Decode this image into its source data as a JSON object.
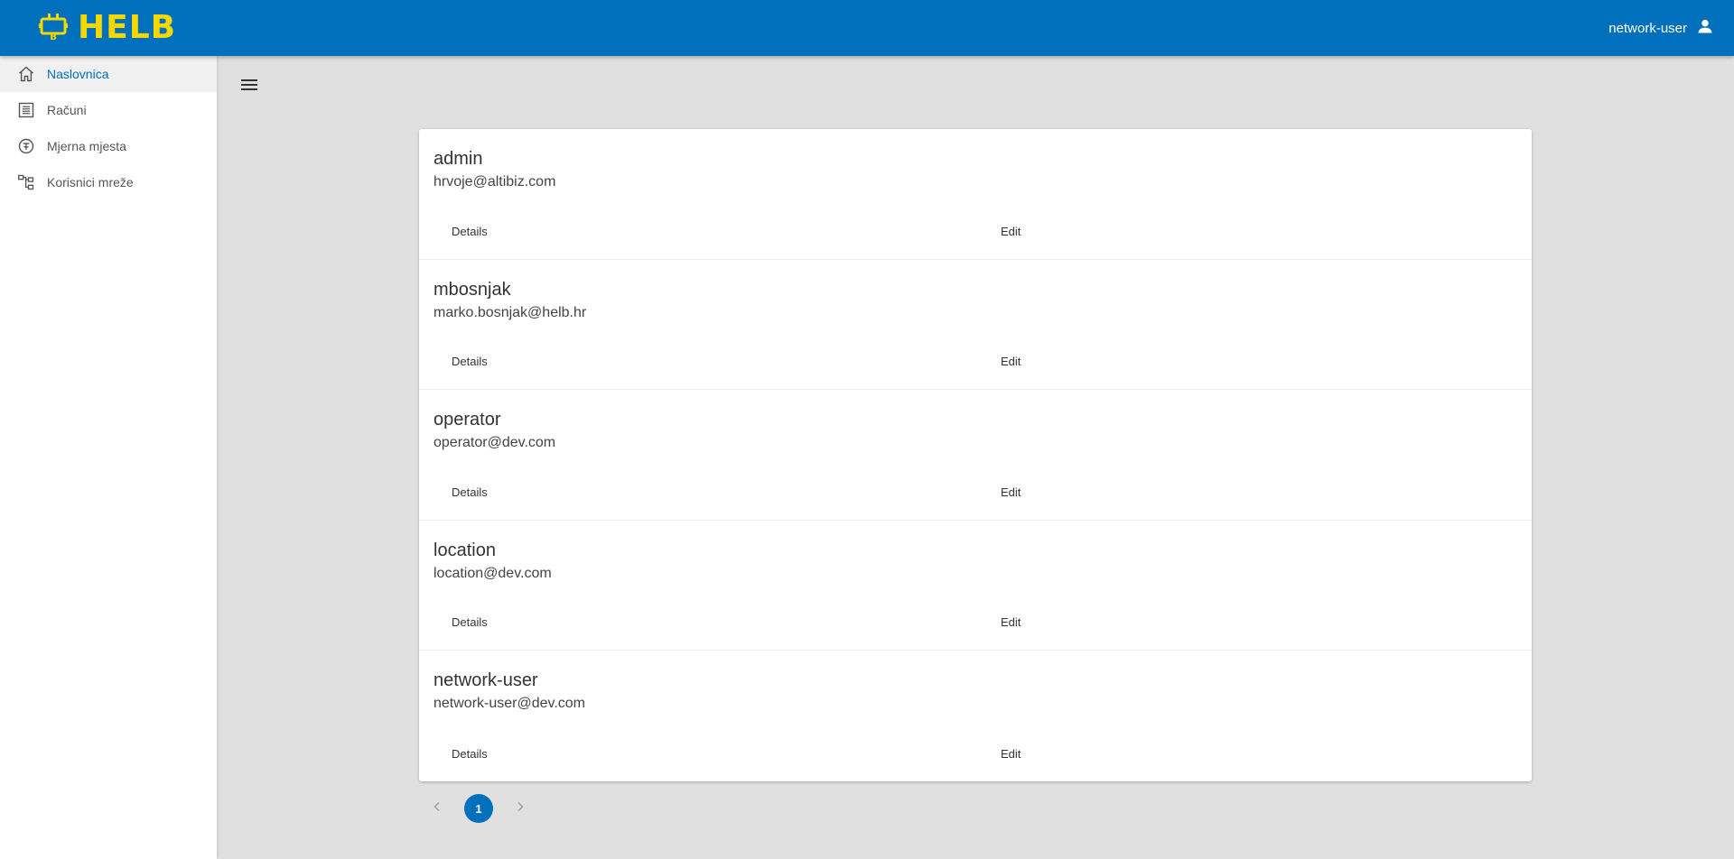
{
  "app": {
    "brand": "HELB",
    "user_name": "network-user",
    "icons": {
      "logo": "plug-b-icon",
      "user": "account-icon",
      "menu": "hamburger-icon"
    },
    "colors": {
      "primary": "#0070bd",
      "brand_yellow": "#f5d800"
    }
  },
  "sidebar": {
    "items": [
      {
        "label": "Naslovnica",
        "icon": "home-icon",
        "active": true
      },
      {
        "label": "Računi",
        "icon": "list-icon",
        "active": false
      },
      {
        "label": "Mjerna mjesta",
        "icon": "meter-icon",
        "active": false
      },
      {
        "label": "Korisnici mreže",
        "icon": "network-tree-icon",
        "active": false
      }
    ]
  },
  "users": [
    {
      "name": "admin",
      "email": "hrvoje@altibiz.com",
      "details_label": "Details",
      "edit_label": "Edit"
    },
    {
      "name": "mbosnjak",
      "email": "marko.bosnjak@helb.hr",
      "details_label": "Details",
      "edit_label": "Edit"
    },
    {
      "name": "operator",
      "email": "operator@dev.com",
      "details_label": "Details",
      "edit_label": "Edit"
    },
    {
      "name": "location",
      "email": "location@dev.com",
      "details_label": "Details",
      "edit_label": "Edit"
    },
    {
      "name": "network-user",
      "email": "network-user@dev.com",
      "details_label": "Details",
      "edit_label": "Edit"
    }
  ],
  "pagination": {
    "current_page": "1",
    "prev_icon": "chevron-left-icon",
    "next_icon": "chevron-right-icon"
  }
}
